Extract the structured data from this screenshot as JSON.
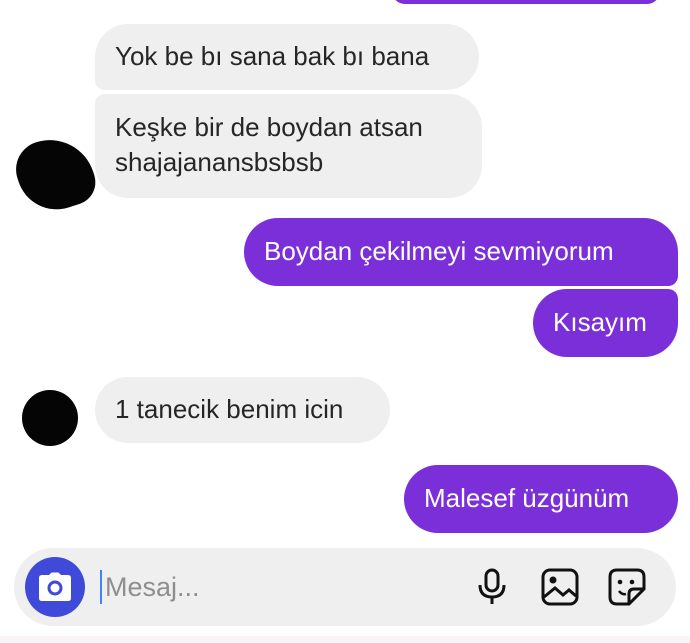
{
  "colors": {
    "incoming_bubble": "#efefef",
    "outgoing_bubble": "#7a2fd8",
    "camera_button": "#3f4bd8",
    "caret": "#3a86ff"
  },
  "messages": {
    "in_1": {
      "text": "Yok be bı sana bak bı bana"
    },
    "in_2": {
      "line1": "Keşke bir de boydan atsan",
      "line2": "shajajanansbsbsb"
    },
    "out_1": {
      "text": "Boydan çekilmeyi sevmiyorum"
    },
    "out_2": {
      "text": "Kısayım"
    },
    "in_3": {
      "text": "1 tanecik benim icin"
    },
    "out_3": {
      "text": "Malesef üzgünüm"
    }
  },
  "composer": {
    "placeholder": "Mesaj...",
    "camera_icon": "camera-icon",
    "mic_icon": "microphone-icon",
    "gallery_icon": "image-gallery-icon",
    "sticker_icon": "sticker-icon"
  }
}
